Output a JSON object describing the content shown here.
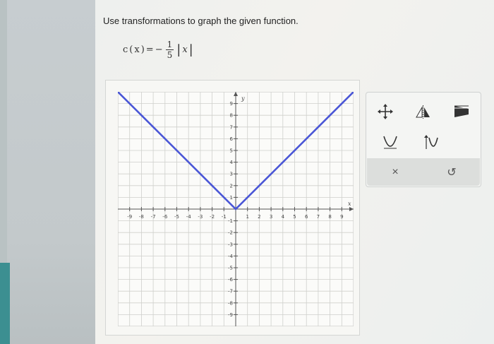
{
  "question": {
    "instructions": "Use transformations to graph the given function.",
    "function_name": "c",
    "variable": "x",
    "coefficient_numerator": "1",
    "coefficient_denominator": "5",
    "abs_expression": "x",
    "equals": "="
  },
  "graph": {
    "x_axis_label": "x",
    "y_axis_label": "y",
    "x_range": [
      -10,
      10
    ],
    "y_range": [
      -10,
      10
    ],
    "x_tick_labels": [
      "-9",
      "-8",
      "-7",
      "-6",
      "-5",
      "-4",
      "-3",
      "-2",
      "-1",
      "1",
      "2",
      "3",
      "4",
      "5",
      "6",
      "7",
      "8",
      "9"
    ],
    "y_tick_labels": [
      "9",
      "8",
      "7",
      "6",
      "5",
      "4",
      "3",
      "2",
      "1",
      "-1",
      "-2",
      "-3",
      "-4",
      "-5",
      "-6",
      "-7",
      "-8",
      "-9"
    ],
    "line_color": "#4a56d6",
    "plotted_function": {
      "type": "absolute-value",
      "vertex": [
        0,
        0
      ],
      "points": [
        [
          -10,
          10
        ],
        [
          0,
          0
        ],
        [
          10,
          10
        ]
      ]
    }
  },
  "toolbox": {
    "tools": [
      {
        "name": "move-tool-icon"
      },
      {
        "name": "reflect-tool-icon"
      },
      {
        "name": "stretch-tool-icon"
      },
      {
        "name": "parabola-tool-icon"
      },
      {
        "name": "shift-parabola-tool-icon"
      }
    ],
    "clear_label": "×",
    "undo_label": "↺"
  }
}
